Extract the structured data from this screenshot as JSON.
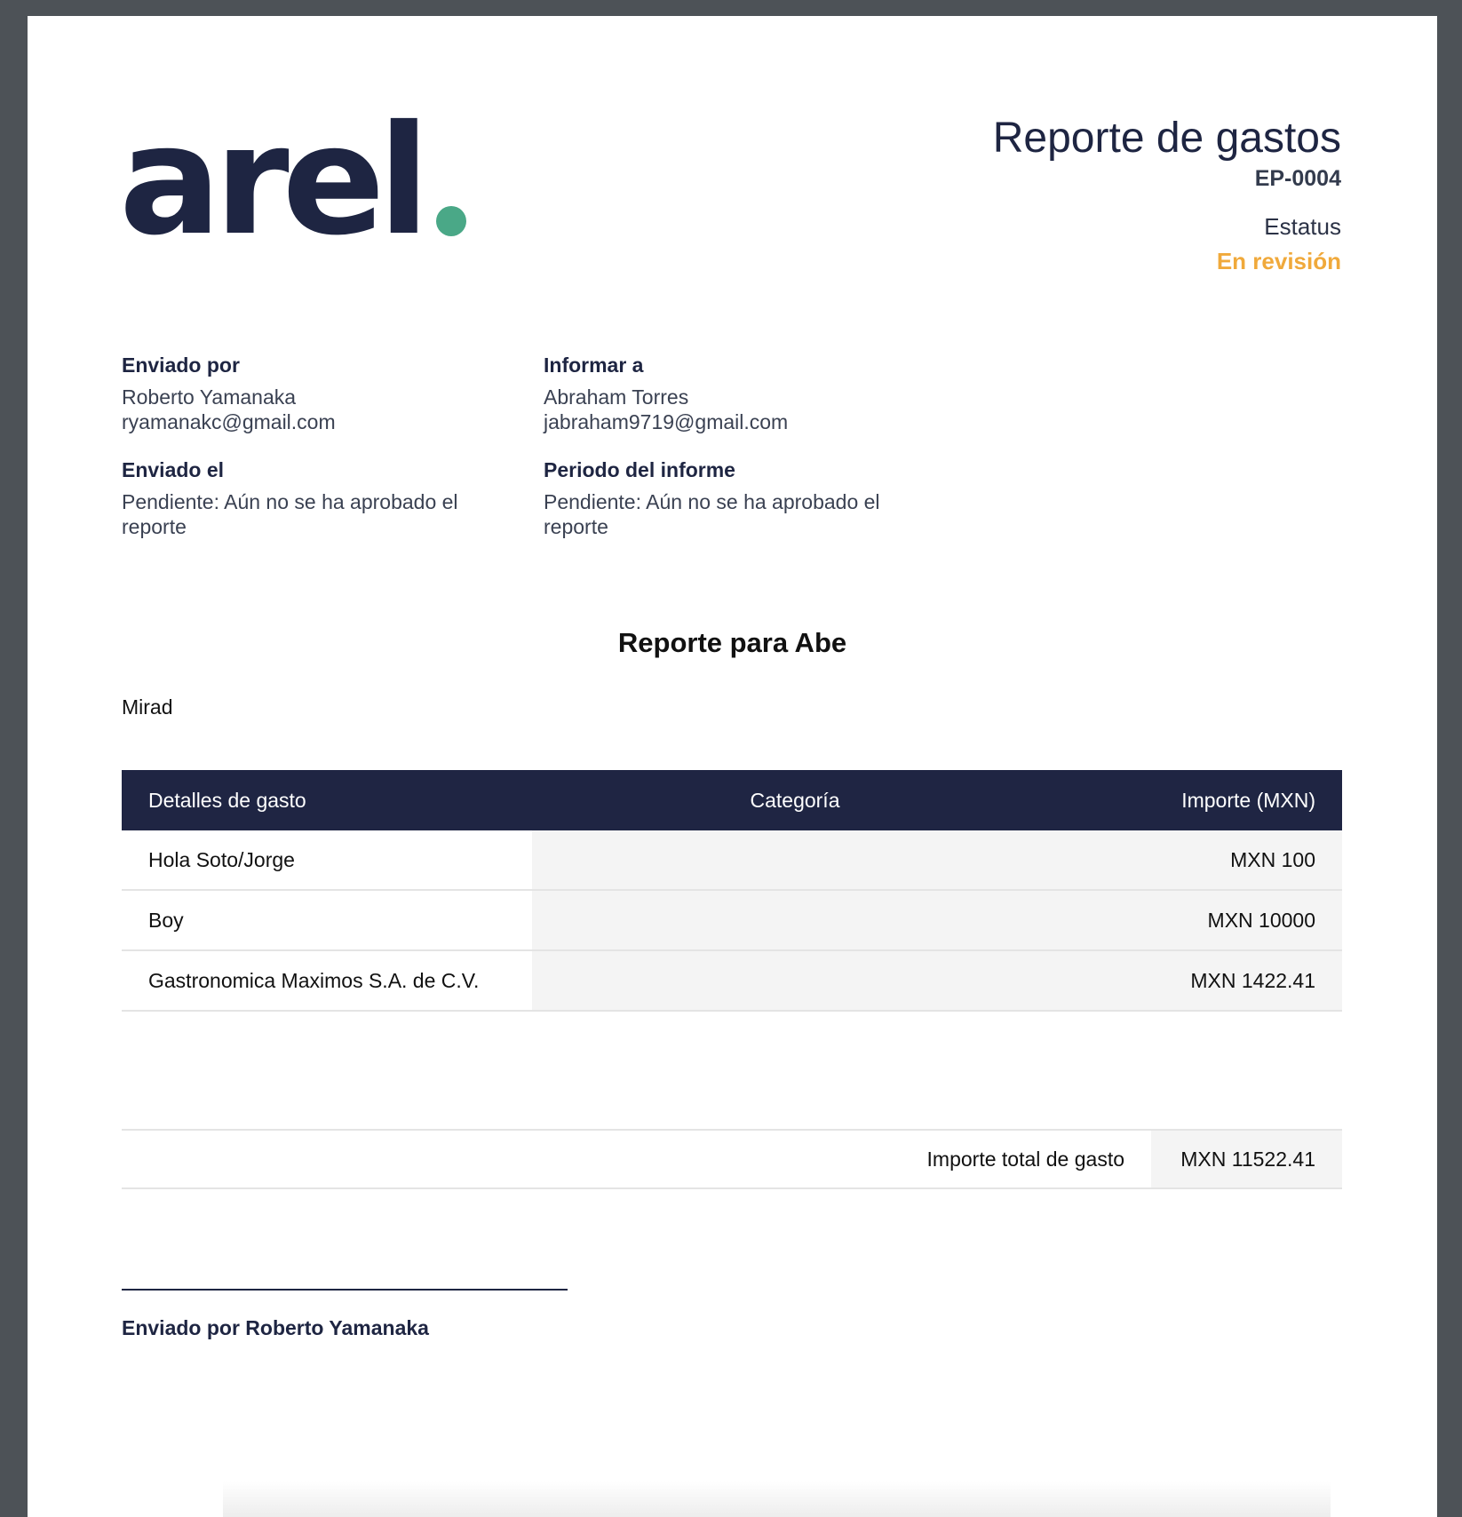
{
  "logo": {
    "text": "arel",
    "dot_color": "#4aa887",
    "text_color": "#1e2542"
  },
  "header": {
    "title": "Reporte de gastos",
    "number": "EP-0004",
    "status_label": "Estatus",
    "status_value": "En revisión",
    "status_color": "#f0a93b"
  },
  "info": {
    "sent_by": {
      "label": "Enviado por",
      "name": "Roberto Yamanaka",
      "email": "ryamanakc@gmail.com"
    },
    "report_to": {
      "label": "Informar a",
      "name": "Abraham Torres",
      "email": "jabraham9719@gmail.com"
    },
    "sent_on": {
      "label": "Enviado el",
      "value": "Pendiente: Aún no se ha aprobado el reporte"
    },
    "period": {
      "label": "Periodo del informe",
      "value": "Pendiente: Aún no se ha aprobado el reporte"
    }
  },
  "report": {
    "title": "Reporte para Abe",
    "description": "Mirad"
  },
  "table": {
    "headers": {
      "detail": "Detalles de gasto",
      "category": "Categoría",
      "amount": "Importe (MXN)"
    },
    "header_color": "#1f2543",
    "rows": [
      {
        "detail": "Hola Soto/Jorge",
        "category": "",
        "amount": "MXN 100"
      },
      {
        "detail": "Boy",
        "category": "",
        "amount": "MXN 10000"
      },
      {
        "detail": "Gastronomica Maximos S.A. de C.V.",
        "category": "",
        "amount": "MXN 1422.41"
      }
    ]
  },
  "total": {
    "label": "Importe total de gasto",
    "value": "MXN 11522.41"
  },
  "signature": {
    "text": "Enviado por Roberto Yamanaka"
  }
}
